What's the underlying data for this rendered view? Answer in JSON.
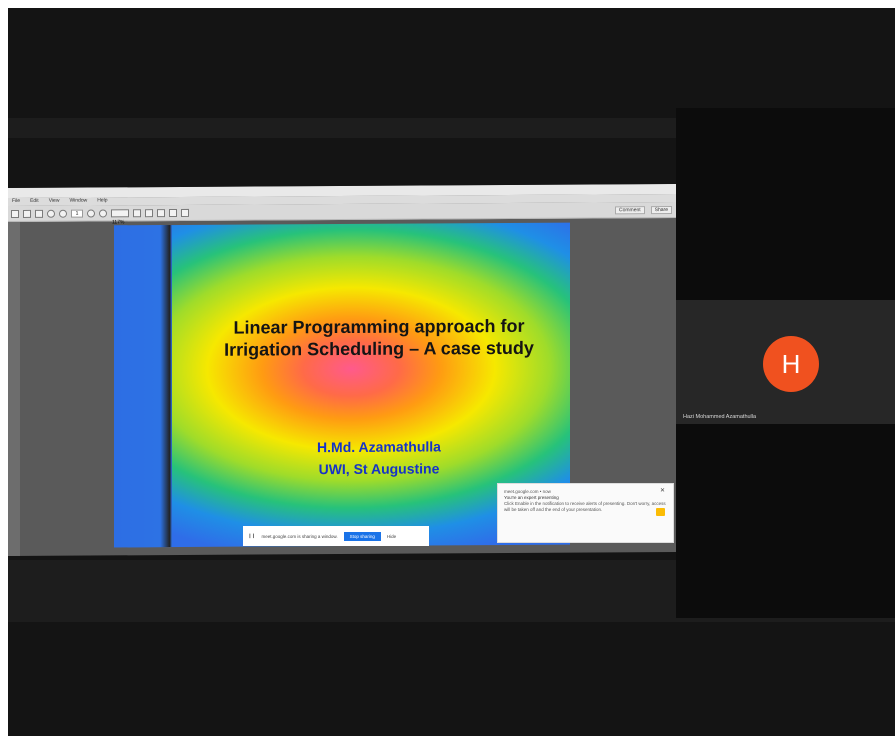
{
  "viewer": {
    "menu_items": [
      "File",
      "Edit",
      "View",
      "Window",
      "Help"
    ],
    "page_number": "1",
    "zoom": "117%",
    "toolbar_right": [
      "Comment",
      "Share"
    ]
  },
  "slide": {
    "title": "Linear Programming approach for Irrigation Scheduling – A case study",
    "author": "H.Md. Azamathulla",
    "affiliation": "UWI, St Augustine"
  },
  "share_bar": {
    "text": "meet.google.com is sharing a window.",
    "stop_label": "Stop sharing",
    "hide_label": "Hide"
  },
  "notification": {
    "source": "meet.google.com • now",
    "title": "You're an expert presenting",
    "body": "Click Enable in the notification to receive alerts of presenting. Don't worry, access will be taken off and the end of your presentation."
  },
  "participant": {
    "initial": "H",
    "name": "Hazi Mohammed Azamathulla",
    "avatar_color": "#f0511f"
  }
}
